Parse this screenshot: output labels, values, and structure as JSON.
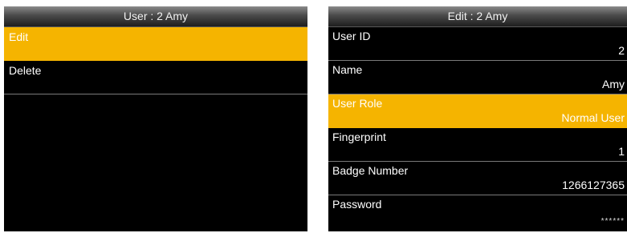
{
  "left_screen": {
    "title": "User : 2 Amy",
    "items": [
      {
        "label": "Edit",
        "selected": true
      },
      {
        "label": "Delete",
        "selected": false
      }
    ]
  },
  "right_screen": {
    "title": "Edit : 2 Amy",
    "fields": [
      {
        "label": "User ID",
        "value": "2",
        "selected": false
      },
      {
        "label": "Name",
        "value": "Amy",
        "selected": false
      },
      {
        "label": "User Role",
        "value": "Normal User",
        "selected": true
      },
      {
        "label": "Fingerprint",
        "value": "1",
        "selected": false
      },
      {
        "label": "Badge Number",
        "value": "1266127365",
        "selected": false
      },
      {
        "label": "Password",
        "value": "******",
        "selected": false
      }
    ]
  },
  "colors": {
    "highlight": "#f5b400",
    "background": "#000000",
    "text": "#ffffff"
  }
}
